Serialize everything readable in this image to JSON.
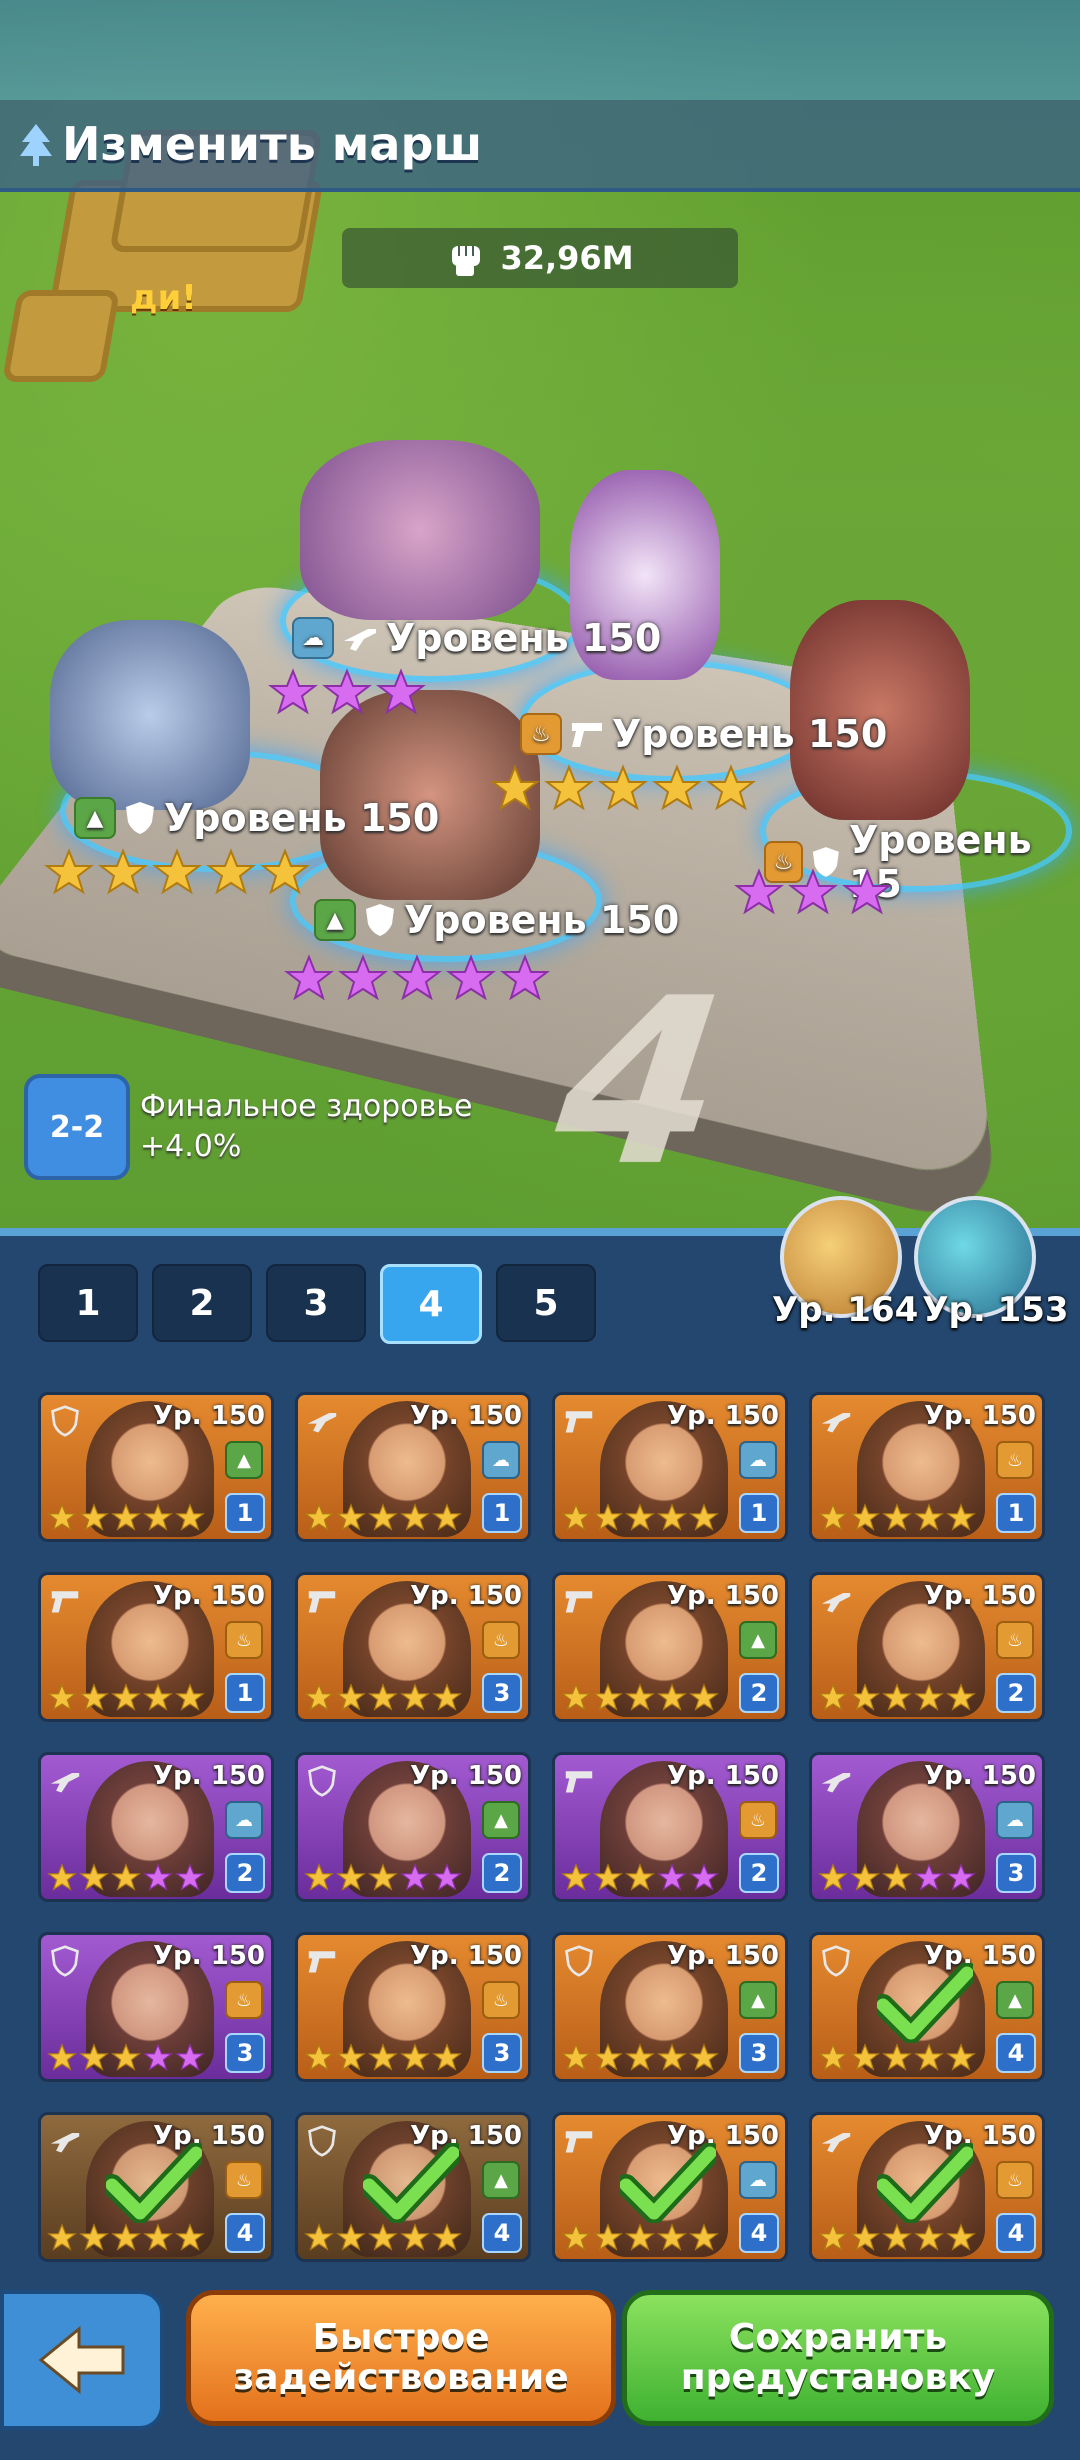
{
  "header": {
    "title": "Изменить марш"
  },
  "power": {
    "value": "32,96M"
  },
  "ticker_text": "ди!",
  "board": {
    "number": "4",
    "heroes": [
      {
        "level_label": "Уровень 150",
        "class_icon": "cloud-badge",
        "type_icon": "rifle-icon",
        "stars": 3,
        "star_color": "purple"
      },
      {
        "level_label": "Уровень 150",
        "class_icon": "fire-badge",
        "type_icon": "pistol-icon",
        "stars": 5,
        "star_color": "gold"
      },
      {
        "level_label": "Уровень 150",
        "class_icon": "mountain-badge",
        "type_icon": "shield-icon",
        "stars": 5,
        "star_color": "gold"
      },
      {
        "level_label": "Уровень 150",
        "class_icon": "mountain-badge",
        "type_icon": "shield-icon",
        "stars": 5,
        "star_color": "purple"
      },
      {
        "level_label": "Уровень 15",
        "class_icon": "fire-badge",
        "type_icon": "shield-icon",
        "stars": 3,
        "star_color": "purple"
      }
    ]
  },
  "bonus": {
    "icon_label": "2-2",
    "line1": "Финальное здоровье",
    "line2": "+4.0%"
  },
  "pets": [
    {
      "name": "eagle-pet",
      "level": "Ур. 164"
    },
    {
      "name": "dragon-pet",
      "level": "Ур. 153"
    }
  ],
  "tabs": [
    "1",
    "2",
    "3",
    "4",
    "5"
  ],
  "active_tab": "4",
  "heroes": [
    {
      "level": "Ур. 150",
      "slot": "1",
      "type": "shield",
      "cls": "green",
      "bg": "orange",
      "selected": false
    },
    {
      "level": "Ур. 150",
      "slot": "1",
      "type": "rifle",
      "cls": "blue",
      "bg": "orange",
      "selected": false
    },
    {
      "level": "Ур. 150",
      "slot": "1",
      "type": "pistol",
      "cls": "blue",
      "bg": "orange",
      "selected": false
    },
    {
      "level": "Ур. 150",
      "slot": "1",
      "type": "rifle",
      "cls": "orange",
      "bg": "orange",
      "selected": false
    },
    {
      "level": "Ур. 150",
      "slot": "1",
      "type": "pistol",
      "cls": "orange",
      "bg": "orange",
      "selected": false
    },
    {
      "level": "Ур. 150",
      "slot": "3",
      "type": "pistol",
      "cls": "orange",
      "bg": "orange",
      "selected": false
    },
    {
      "level": "Ур. 150",
      "slot": "2",
      "type": "pistol",
      "cls": "green",
      "bg": "orange",
      "selected": false
    },
    {
      "level": "Ур. 150",
      "slot": "2",
      "type": "rifle",
      "cls": "orange",
      "bg": "orange",
      "selected": false
    },
    {
      "level": "Ур. 150",
      "slot": "2",
      "type": "rifle",
      "cls": "blue",
      "bg": "purple",
      "selected": false
    },
    {
      "level": "Ур. 150",
      "slot": "2",
      "type": "shield",
      "cls": "green",
      "bg": "purple",
      "selected": false
    },
    {
      "level": "Ур. 150",
      "slot": "2",
      "type": "pistol",
      "cls": "orange",
      "bg": "purple",
      "selected": false
    },
    {
      "level": "Ур. 150",
      "slot": "3",
      "type": "rifle",
      "cls": "blue",
      "bg": "purple",
      "selected": false
    },
    {
      "level": "Ур. 150",
      "slot": "3",
      "type": "shield",
      "cls": "orange",
      "bg": "purple",
      "selected": false
    },
    {
      "level": "Ур. 150",
      "slot": "3",
      "type": "pistol",
      "cls": "orange",
      "bg": "orange",
      "selected": false
    },
    {
      "level": "Ур. 150",
      "slot": "3",
      "type": "shield",
      "cls": "green",
      "bg": "orange",
      "selected": false
    },
    {
      "level": "Ур. 150",
      "slot": "4",
      "type": "shield",
      "cls": "green",
      "bg": "orange",
      "selected": true
    },
    {
      "level": "Ур. 150",
      "slot": "4",
      "type": "rifle",
      "cls": "orange",
      "bg": "dark",
      "selected": true
    },
    {
      "level": "Ур. 150",
      "slot": "4",
      "type": "shield",
      "cls": "green",
      "bg": "dark",
      "selected": true
    },
    {
      "level": "Ур. 150",
      "slot": "4",
      "type": "pistol",
      "cls": "blue",
      "bg": "orange",
      "selected": true
    },
    {
      "level": "Ур. 150",
      "slot": "4",
      "type": "rifle",
      "cls": "orange",
      "bg": "orange",
      "selected": true
    }
  ],
  "buttons": {
    "quick_deploy": "Быстрое задействование",
    "save_preset": "Сохранить предустановку"
  },
  "colors": {
    "panel": "#24476f",
    "accent_tab": "#38a6ee",
    "orange_button": "#e3711c",
    "green_button": "#3fb131"
  }
}
